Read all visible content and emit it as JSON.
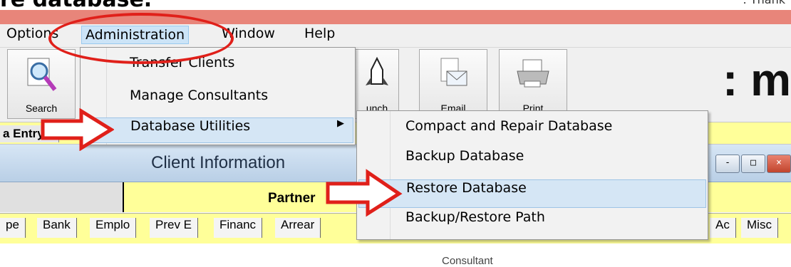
{
  "caption": {
    "text": "re database.",
    "right_text": ": Thank"
  },
  "menubar": {
    "items": [
      "Options",
      "Administration",
      "Window",
      "Help"
    ]
  },
  "toolbar": {
    "buttons": [
      "Search",
      "unch",
      "Email",
      "Print"
    ],
    "brand": ": m"
  },
  "entrybar": {
    "label": "a Entry V"
  },
  "client_panel": {
    "title": "Client Information",
    "partner_label": "Partner",
    "window_buttons": [
      "-",
      "□",
      "×"
    ]
  },
  "tabs": [
    "pe",
    "Bank",
    "Emplo",
    "Prev E",
    "Financ",
    "Arrear",
    "Ac",
    "Misc"
  ],
  "bottom_text": "Consultant",
  "admin_menu": {
    "items": [
      "Transfer Clients",
      "Manage Consultants",
      "Database Utilities"
    ],
    "submenu_arrow": "▶"
  },
  "db_utilities_menu": {
    "items": [
      "Compact and Repair Database",
      "Backup Database",
      "Restore Database",
      "Backup/Restore Path"
    ],
    "highlighted": "Restore Database"
  },
  "colors": {
    "annotation": "#e0201a",
    "highlight": "#d5e6f5",
    "yellow": "#ffff99"
  }
}
